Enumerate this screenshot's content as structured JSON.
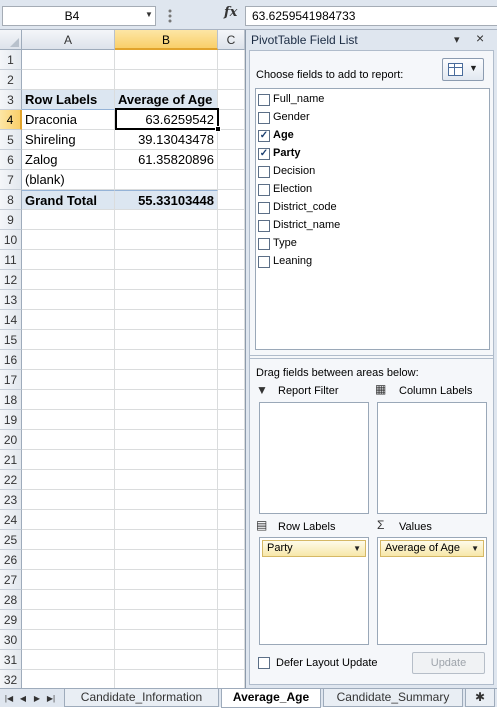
{
  "formula_bar": {
    "name_box": "B4",
    "fx": "fx",
    "formula": "63.6259541984733"
  },
  "grid": {
    "columns": [
      "A",
      "B",
      "C"
    ],
    "rows": [
      {
        "num": "1",
        "a": "",
        "b": ""
      },
      {
        "num": "2",
        "a": "",
        "b": ""
      },
      {
        "num": "3",
        "a": "Row Labels",
        "b": "Average of Age"
      },
      {
        "num": "4",
        "a": "Draconia",
        "b": "63.6259542"
      },
      {
        "num": "5",
        "a": "Shireling",
        "b": "39.13043478"
      },
      {
        "num": "6",
        "a": "Zalog",
        "b": "61.35820896"
      },
      {
        "num": "7",
        "a": "(blank)",
        "b": ""
      },
      {
        "num": "8",
        "a": "Grand Total",
        "b": "55.33103448"
      },
      {
        "num": "9"
      },
      {
        "num": "10"
      },
      {
        "num": "11"
      },
      {
        "num": "12"
      },
      {
        "num": "13"
      },
      {
        "num": "14"
      },
      {
        "num": "15"
      },
      {
        "num": "16"
      },
      {
        "num": "17"
      },
      {
        "num": "18"
      },
      {
        "num": "19"
      },
      {
        "num": "20"
      },
      {
        "num": "21"
      },
      {
        "num": "22"
      },
      {
        "num": "23"
      },
      {
        "num": "24"
      },
      {
        "num": "25"
      },
      {
        "num": "26"
      },
      {
        "num": "27"
      },
      {
        "num": "28"
      },
      {
        "num": "29"
      },
      {
        "num": "30"
      },
      {
        "num": "31"
      },
      {
        "num": "32"
      }
    ]
  },
  "sheet_tabs": {
    "tabs": [
      "Candidate_Information",
      "Average_Age",
      "Candidate_Summary"
    ],
    "active": "Average_Age"
  },
  "pivot_panel": {
    "title": "PivotTable Field List",
    "choose_label": "Choose fields to add to report:",
    "fields": [
      {
        "name": "Full_name",
        "checked": false
      },
      {
        "name": "Gender",
        "checked": false
      },
      {
        "name": "Age",
        "checked": true
      },
      {
        "name": "Party",
        "checked": true
      },
      {
        "name": "Decision",
        "checked": false
      },
      {
        "name": "Election",
        "checked": false
      },
      {
        "name": "District_code",
        "checked": false
      },
      {
        "name": "District_name",
        "checked": false
      },
      {
        "name": "Type",
        "checked": false
      },
      {
        "name": "Leaning",
        "checked": false
      }
    ],
    "drag_label": "Drag fields between areas below:",
    "areas": {
      "report_filter": "Report Filter",
      "column_labels": "Column Labels",
      "row_labels": "Row Labels",
      "values": "Values"
    },
    "row_labels_chip": "Party",
    "values_chip": "Average of Age",
    "defer_label": "Defer Layout Update",
    "update_label": "Update"
  }
}
